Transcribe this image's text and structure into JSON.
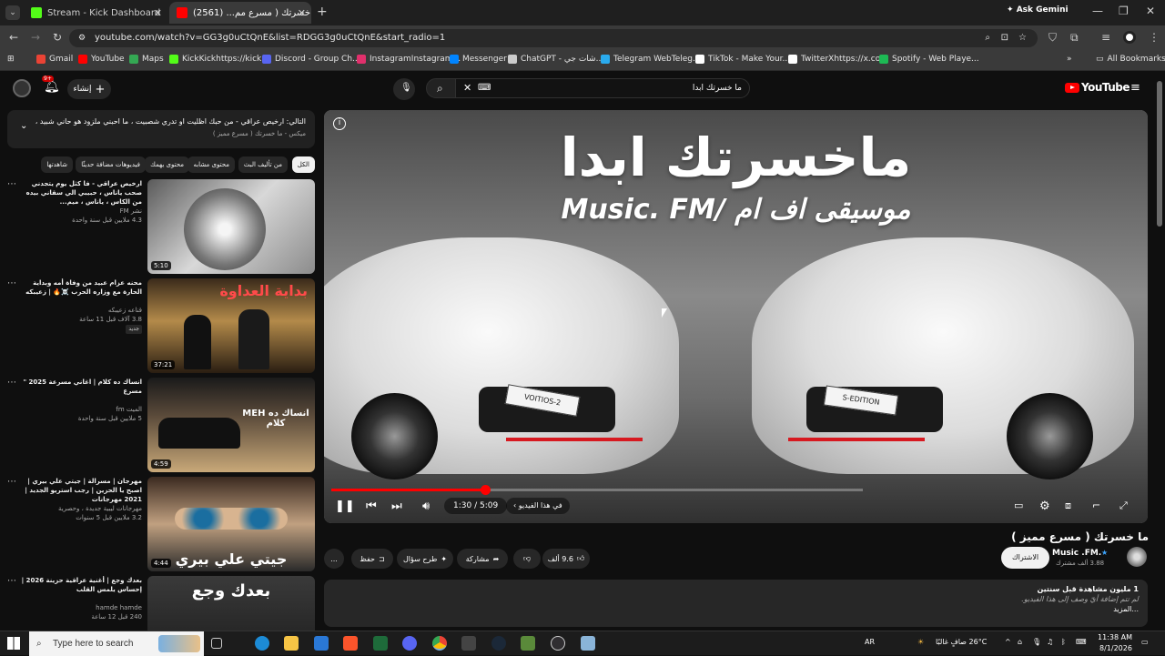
{
  "browser": {
    "tabs": [
      {
        "title": "Stream - Kick Dashboard",
        "active": false,
        "color": "#53fc18"
      },
      {
        "title": "ما خسرتك ( مسرع مم... (2561)",
        "active": true,
        "color": "#ff0000"
      }
    ],
    "new_tab": "+",
    "ask_gemini": "Ask Gemini",
    "url": "youtube.com/watch?v=GG3g0uCtQnE&list=RDGG3g0uCtQnE&start_radio=1",
    "bookmarks": [
      {
        "label": "Gmail",
        "color": "#ea4335"
      },
      {
        "label": "YouTube",
        "color": "#ff0000"
      },
      {
        "label": "Maps",
        "color": "#34a853"
      },
      {
        "label": "KickKickhttps://kick...",
        "color": "#53fc18"
      },
      {
        "label": "Discord - Group Ch...",
        "color": "#5865f2"
      },
      {
        "label": "InstagramInstagram...",
        "color": "#e1306c"
      },
      {
        "label": "Messenger",
        "color": "#0084ff"
      },
      {
        "label": "ChatGPT - شات جي...",
        "color": "#cccccc"
      },
      {
        "label": "Telegram WebTeleg...",
        "color": "#2aabee"
      },
      {
        "label": "TikTok - Make Your...",
        "color": "#ffffff"
      },
      {
        "label": "TwitterXhttps://x.com",
        "color": "#ffffff"
      },
      {
        "label": "Spotify - Web Playe...",
        "color": "#1db954"
      }
    ],
    "all_bookmarks": "All Bookmarks"
  },
  "youtube": {
    "search_value": "ما خسرتك ابدا",
    "create_label": "إنشاء",
    "notif_count": "9+",
    "logo_text": "YouTube",
    "playlist_title": "التالي: ارخيص عراقي - من حبك اظليت او تدري شصبيت ، ما احبني ملزود هو حاني شبيد ، حنت انسطت ...",
    "playlist_sub": "ميكس - ما خسرتك ( مسرع مميز )",
    "chips": [
      {
        "label": "الكل",
        "selected": true
      },
      {
        "label": "من تأليف البث",
        "selected": false
      },
      {
        "label": "محتوى مشابه",
        "selected": false
      },
      {
        "label": "محتوى يهمك",
        "selected": false
      },
      {
        "label": "فيديوهات مضافة حديثًا",
        "selected": false
      },
      {
        "label": "شاهدتها",
        "selected": false
      }
    ],
    "player": {
      "overlay_title": "ماخسرتك ابدا",
      "overlay_sub": "Music. FM/ موسيقى اف ام",
      "plate_left": "VOITIOS-2",
      "plate_right": "S-EDITION",
      "time": "1:30 / 5:09",
      "chapter": "في هذا الفيديو",
      "progress": 0.29
    },
    "video_title": "ما خسرتك ( مسرع مميز )",
    "channel_name": "Music .FM.",
    "subscribers": "3.88 ألف مشترك",
    "subscribe_label": "الاشتراك",
    "likes": "9.6 ألف",
    "share": "مشاركة",
    "ask": "طرح سؤال",
    "save": "حفظ",
    "more": "...",
    "description": {
      "views": "1 مليون مشاهدة قبل سنتين",
      "line1": "لم تتم إضافة أيّ وصف إلى هذا الفيديو.",
      "line2": "...المزيد"
    },
    "recommendations": [
      {
        "title": "ارخيص عراقي - فا كثل يوم يتجدني صحب ياناس ، حبيبي الي سقاني بيده من الكاس ، ياناس ، ميم...",
        "channel": "نشر FM",
        "stats": "4.3 ملايين  قبل سنة واحدة",
        "duration": "5:10",
        "colors": [
          "#8c8c8c",
          "#d8d8d8"
        ]
      },
      {
        "title": "محنه عزام عبيد من وفاة أمه وبداية الحارة مع وزاره الحرب ☠️🔥 | زعيبكه",
        "channel": "قناعه زعيبكه",
        "stats": "3.8 آلاف  قبل 11 ساعة",
        "duration": "37:21",
        "colors": [
          "#3a2a1a",
          "#b38a4a"
        ],
        "overlay": "بداية العداوة",
        "badge": "جديد"
      },
      {
        "title": "انساك ده كلام | اغاني مسرعة 2025 \" مسرع",
        "channel": "الميت fm",
        "stats": "5 ملايين  قبل سنة واحدة",
        "duration": "4:59",
        "colors": [
          "#2a2a2a",
          "#c8a878"
        ],
        "overlay": "MEH انساك ده كلام"
      },
      {
        "title": "مهرجان | مسرالة | جيتي علي بيري | اصبح يا الحزين | رجب استريو الجديد | 2021 مهرجانات",
        "channel": "مهرجانات ليبية جديدة ، وحصرية",
        "stats": "3.2 ملايين  قبل 5 سنوات",
        "duration": "4:44",
        "colors": [
          "#3b2a20",
          "#c0a080"
        ],
        "overlay": "جيتي علي بيري"
      },
      {
        "title": "بعدك وجع | أغنية عراقية حزينة 2026 | إحساس يلمس القلب",
        "channel": "hamde hamde",
        "stats": "240  قبل 12 ساعة",
        "duration": "",
        "colors": [
          "#2a2a2a",
          "#5a5a5a"
        ],
        "overlay": "بعدك وجع",
        "badge": "جديد"
      }
    ]
  },
  "taskbar": {
    "search_placeholder": "Type here to search",
    "lang": "AR",
    "weather": "26°C  صافٍ غالبًا",
    "time": "11:38 AM",
    "date": "8/1/2026"
  }
}
